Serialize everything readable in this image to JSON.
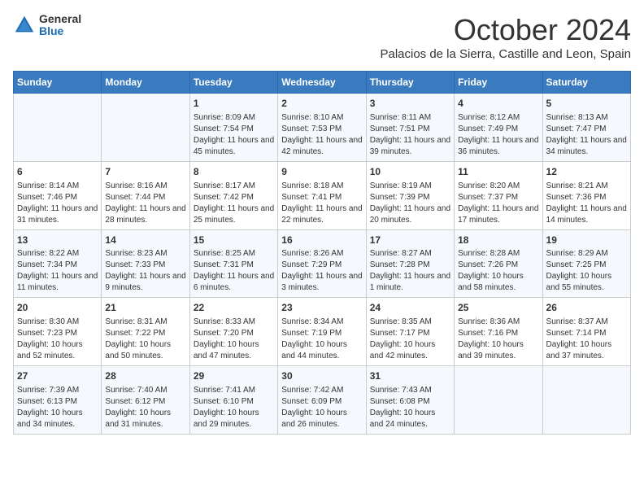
{
  "header": {
    "logo_general": "General",
    "logo_blue": "Blue",
    "month_title": "October 2024",
    "location": "Palacios de la Sierra, Castille and Leon, Spain"
  },
  "days_of_week": [
    "Sunday",
    "Monday",
    "Tuesday",
    "Wednesday",
    "Thursday",
    "Friday",
    "Saturday"
  ],
  "weeks": [
    [
      {
        "day": "",
        "detail": ""
      },
      {
        "day": "",
        "detail": ""
      },
      {
        "day": "1",
        "detail": "Sunrise: 8:09 AM\nSunset: 7:54 PM\nDaylight: 11 hours and 45 minutes."
      },
      {
        "day": "2",
        "detail": "Sunrise: 8:10 AM\nSunset: 7:53 PM\nDaylight: 11 hours and 42 minutes."
      },
      {
        "day": "3",
        "detail": "Sunrise: 8:11 AM\nSunset: 7:51 PM\nDaylight: 11 hours and 39 minutes."
      },
      {
        "day": "4",
        "detail": "Sunrise: 8:12 AM\nSunset: 7:49 PM\nDaylight: 11 hours and 36 minutes."
      },
      {
        "day": "5",
        "detail": "Sunrise: 8:13 AM\nSunset: 7:47 PM\nDaylight: 11 hours and 34 minutes."
      }
    ],
    [
      {
        "day": "6",
        "detail": "Sunrise: 8:14 AM\nSunset: 7:46 PM\nDaylight: 11 hours and 31 minutes."
      },
      {
        "day": "7",
        "detail": "Sunrise: 8:16 AM\nSunset: 7:44 PM\nDaylight: 11 hours and 28 minutes."
      },
      {
        "day": "8",
        "detail": "Sunrise: 8:17 AM\nSunset: 7:42 PM\nDaylight: 11 hours and 25 minutes."
      },
      {
        "day": "9",
        "detail": "Sunrise: 8:18 AM\nSunset: 7:41 PM\nDaylight: 11 hours and 22 minutes."
      },
      {
        "day": "10",
        "detail": "Sunrise: 8:19 AM\nSunset: 7:39 PM\nDaylight: 11 hours and 20 minutes."
      },
      {
        "day": "11",
        "detail": "Sunrise: 8:20 AM\nSunset: 7:37 PM\nDaylight: 11 hours and 17 minutes."
      },
      {
        "day": "12",
        "detail": "Sunrise: 8:21 AM\nSunset: 7:36 PM\nDaylight: 11 hours and 14 minutes."
      }
    ],
    [
      {
        "day": "13",
        "detail": "Sunrise: 8:22 AM\nSunset: 7:34 PM\nDaylight: 11 hours and 11 minutes."
      },
      {
        "day": "14",
        "detail": "Sunrise: 8:23 AM\nSunset: 7:33 PM\nDaylight: 11 hours and 9 minutes."
      },
      {
        "day": "15",
        "detail": "Sunrise: 8:25 AM\nSunset: 7:31 PM\nDaylight: 11 hours and 6 minutes."
      },
      {
        "day": "16",
        "detail": "Sunrise: 8:26 AM\nSunset: 7:29 PM\nDaylight: 11 hours and 3 minutes."
      },
      {
        "day": "17",
        "detail": "Sunrise: 8:27 AM\nSunset: 7:28 PM\nDaylight: 11 hours and 1 minute."
      },
      {
        "day": "18",
        "detail": "Sunrise: 8:28 AM\nSunset: 7:26 PM\nDaylight: 10 hours and 58 minutes."
      },
      {
        "day": "19",
        "detail": "Sunrise: 8:29 AM\nSunset: 7:25 PM\nDaylight: 10 hours and 55 minutes."
      }
    ],
    [
      {
        "day": "20",
        "detail": "Sunrise: 8:30 AM\nSunset: 7:23 PM\nDaylight: 10 hours and 52 minutes."
      },
      {
        "day": "21",
        "detail": "Sunrise: 8:31 AM\nSunset: 7:22 PM\nDaylight: 10 hours and 50 minutes."
      },
      {
        "day": "22",
        "detail": "Sunrise: 8:33 AM\nSunset: 7:20 PM\nDaylight: 10 hours and 47 minutes."
      },
      {
        "day": "23",
        "detail": "Sunrise: 8:34 AM\nSunset: 7:19 PM\nDaylight: 10 hours and 44 minutes."
      },
      {
        "day": "24",
        "detail": "Sunrise: 8:35 AM\nSunset: 7:17 PM\nDaylight: 10 hours and 42 minutes."
      },
      {
        "day": "25",
        "detail": "Sunrise: 8:36 AM\nSunset: 7:16 PM\nDaylight: 10 hours and 39 minutes."
      },
      {
        "day": "26",
        "detail": "Sunrise: 8:37 AM\nSunset: 7:14 PM\nDaylight: 10 hours and 37 minutes."
      }
    ],
    [
      {
        "day": "27",
        "detail": "Sunrise: 7:39 AM\nSunset: 6:13 PM\nDaylight: 10 hours and 34 minutes."
      },
      {
        "day": "28",
        "detail": "Sunrise: 7:40 AM\nSunset: 6:12 PM\nDaylight: 10 hours and 31 minutes."
      },
      {
        "day": "29",
        "detail": "Sunrise: 7:41 AM\nSunset: 6:10 PM\nDaylight: 10 hours and 29 minutes."
      },
      {
        "day": "30",
        "detail": "Sunrise: 7:42 AM\nSunset: 6:09 PM\nDaylight: 10 hours and 26 minutes."
      },
      {
        "day": "31",
        "detail": "Sunrise: 7:43 AM\nSunset: 6:08 PM\nDaylight: 10 hours and 24 minutes."
      },
      {
        "day": "",
        "detail": ""
      },
      {
        "day": "",
        "detail": ""
      }
    ]
  ]
}
